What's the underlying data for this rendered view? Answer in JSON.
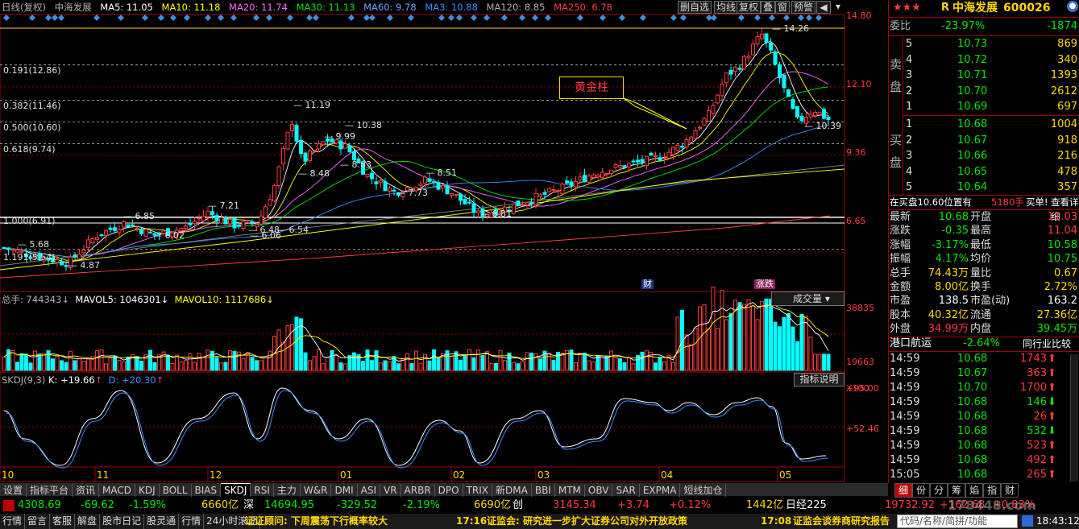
{
  "infobar": {
    "period": "日线(复权)",
    "stock_name": "中海发展",
    "ma5": "MA5: 11.05",
    "ma10": "MA10: 11.18",
    "ma20": "MA20: 11.74",
    "ma30": "MA30: 11.13",
    "ma60": "MA60: 9.78",
    "ma3": "MA3: 10.88",
    "ma120": "MA120: 8.85",
    "ma250": "MA250: 6.78",
    "btn_fav": "删自选",
    "btn_avg": "均线",
    "btn_restore": "复权",
    "btn_overlay": "叠",
    "btn_window": "窗",
    "btn_warn": "预警"
  },
  "colors": {
    "up": "#ff3a3a",
    "down": "#00ffff",
    "ma5": "#ffffff",
    "ma10": "#ffff00",
    "ma20": "#ff66ff",
    "ma30": "#00e600",
    "ma60": "#3c8cff",
    "ma120": "#808080",
    "ma250": "#ff3a3a",
    "panel_border": "#a00000"
  },
  "price_axis": [
    "14.80",
    "12.10",
    "9.36",
    "6.65"
  ],
  "fib_levels": [
    "0.191(12.86)",
    "0.382(11.46)",
    "0.500(10.60)",
    "0.618(9.74)",
    "1.000(6.91)",
    "1.191(5.54)"
  ],
  "price_annotations": [
    "14.26",
    "11.19",
    "9.99",
    "10.38",
    "8.48",
    "8.83",
    "8.51",
    "7.73",
    "6.81",
    "7.21",
    "6.85",
    "6.02",
    "6.48",
    "6.54",
    "6.06",
    "5.68",
    "4.87",
    "10.39"
  ],
  "golden_label": "黄金柱",
  "event_markers": [
    "财",
    "涨跌"
  ],
  "volume": {
    "label_total": "总手: 744343",
    "label_mavol5": "MAVOL5: 1046301",
    "label_mavol10": "MAVOL10: 1117686",
    "dropdown": "成交量",
    "axis": [
      "38835",
      "19663",
      "X100"
    ]
  },
  "indicator": {
    "label_name": "SKDJ(9,3)",
    "label_k": "K: +19.66",
    "label_d": "D: +20.30",
    "button": "指标说明",
    "axis": [
      "+95.00",
      "+52.46"
    ]
  },
  "months": [
    "10",
    "11",
    "12",
    "01",
    "02",
    "03",
    "04",
    "05"
  ],
  "quote": {
    "stars": "★★★",
    "tag": "R",
    "name": "中海发展",
    "code": "600026",
    "weibi_label": "委比",
    "weibi_pct": "-23.97%",
    "weibi_val": "-1874",
    "sell_label": "卖盘",
    "buy_label": "买盘",
    "asks": [
      {
        "lvl": "5",
        "price": "10.73",
        "vol": "869"
      },
      {
        "lvl": "4",
        "price": "10.72",
        "vol": "340"
      },
      {
        "lvl": "3",
        "price": "10.71",
        "vol": "1393"
      },
      {
        "lvl": "2",
        "price": "10.70",
        "vol": "2612"
      },
      {
        "lvl": "1",
        "price": "10.69",
        "vol": "697"
      }
    ],
    "bids": [
      {
        "lvl": "1",
        "price": "10.68",
        "vol": "1004"
      },
      {
        "lvl": "2",
        "price": "10.67",
        "vol": "918"
      },
      {
        "lvl": "3",
        "price": "10.66",
        "vol": "216"
      },
      {
        "lvl": "4",
        "price": "10.65",
        "vol": "478"
      },
      {
        "lvl": "5",
        "price": "10.64",
        "vol": "357"
      }
    ],
    "alert_text": "在买盘10.60位置有",
    "alert_vol": "5180手",
    "alert_action": "买单!",
    "alert_link": "查看详细",
    "stats": [
      {
        "l1": "最新",
        "v1": "10.68",
        "l2": "开盘",
        "v2": "11.03"
      },
      {
        "l1": "涨跌",
        "v1": "-0.35",
        "l2": "最高",
        "v2": "11.04"
      },
      {
        "l1": "涨幅",
        "v1": "-3.17%",
        "l2": "最低",
        "v2": "10.58"
      },
      {
        "l1": "振幅",
        "v1": "4.17%",
        "l2": "均价",
        "v2": "10.75"
      },
      {
        "l1": "总手",
        "v1": "74.43万",
        "l2": "量比",
        "v2": "0.67"
      },
      {
        "l1": "金额",
        "v1": "8.00亿",
        "l2": "换手",
        "v2": "2.72%"
      },
      {
        "l1": "市盈",
        "v1": "138.5",
        "l2": "市盈(动)",
        "v2": "163.2"
      },
      {
        "l1": "股本",
        "v1": "40.32亿",
        "l2": "流通",
        "v2": "27.36亿"
      },
      {
        "l1": "外盘",
        "v1": "34.99万",
        "l2": "内盘",
        "v2": "39.45万"
      }
    ],
    "sector_name": "港口航运",
    "sector_pct": "-2.64%",
    "sector_link": "同行业比较",
    "ticks": [
      {
        "t": "14:59",
        "p": "10.68",
        "v": "1743",
        "d": "up"
      },
      {
        "t": "14:59",
        "p": "10.67",
        "v": "363",
        "d": "up"
      },
      {
        "t": "14:59",
        "p": "10.70",
        "v": "1700",
        "d": "up"
      },
      {
        "t": "14:59",
        "p": "10.68",
        "v": "146",
        "d": "down"
      },
      {
        "t": "14:59",
        "p": "10.68",
        "v": "26",
        "d": "up"
      },
      {
        "t": "14:59",
        "p": "10.68",
        "v": "532",
        "d": "down"
      },
      {
        "t": "14:59",
        "p": "10.68",
        "v": "523",
        "d": "up"
      },
      {
        "t": "14:59",
        "p": "10.68",
        "v": "492",
        "d": "up"
      },
      {
        "t": "15:05",
        "p": "10.68",
        "v": "265",
        "d": "up"
      }
    ]
  },
  "tabs": [
    "设置",
    "指标平台",
    "资讯",
    "MACD",
    "KDJ",
    "BOLL",
    "BIAS",
    "SKDJ",
    "RSI",
    "主力",
    "W&R",
    "DMI",
    "ASI",
    "VR",
    "ARBR",
    "DPO",
    "TRIX",
    "新DMA",
    "BBI",
    "MTM",
    "OBV",
    "SAR",
    "EXPMA",
    "短线加仓"
  ],
  "active_tab": "SKDJ",
  "quote_tabs": [
    "细",
    "份",
    "分",
    "筹",
    "焰",
    "指",
    "财"
  ],
  "ticker": {
    "sh_index": "4308.69",
    "sh_chg": "-69.62",
    "sh_pct": "-1.59%",
    "sh_amt": "6660亿",
    "sz_label": "深",
    "sz_index": "14694.95",
    "sz_chg": "-329.52",
    "sz_pct": "-2.19%",
    "sz_amt": "6690亿",
    "cy_label": "创",
    "cy_index": "3145.34",
    "cy_chg": "+3.74",
    "cy_pct": "+0.12%",
    "cy_amt": "1442亿",
    "nk_label": "日经225",
    "nk_index": "19732.92",
    "nk_chg": "+162.68",
    "nk_pct": "+0.83%"
  },
  "status": {
    "items": [
      "行情",
      "留言",
      "客服",
      "解盘",
      "股市日记",
      "股灵通",
      "行情",
      "24小时滚动"
    ],
    "news1": "证证顾问: 下周震荡下行概率较大",
    "news2_time": "17:16",
    "news2": "证监会: 研究进一步扩大证券公司对外开放政策",
    "news3_time": "17:08",
    "news3": "证监会谈券商研究报告",
    "search_hint": "代码/名称/简拼/功能",
    "clock": "18:43:12",
    "watermark": "178448.com"
  }
}
